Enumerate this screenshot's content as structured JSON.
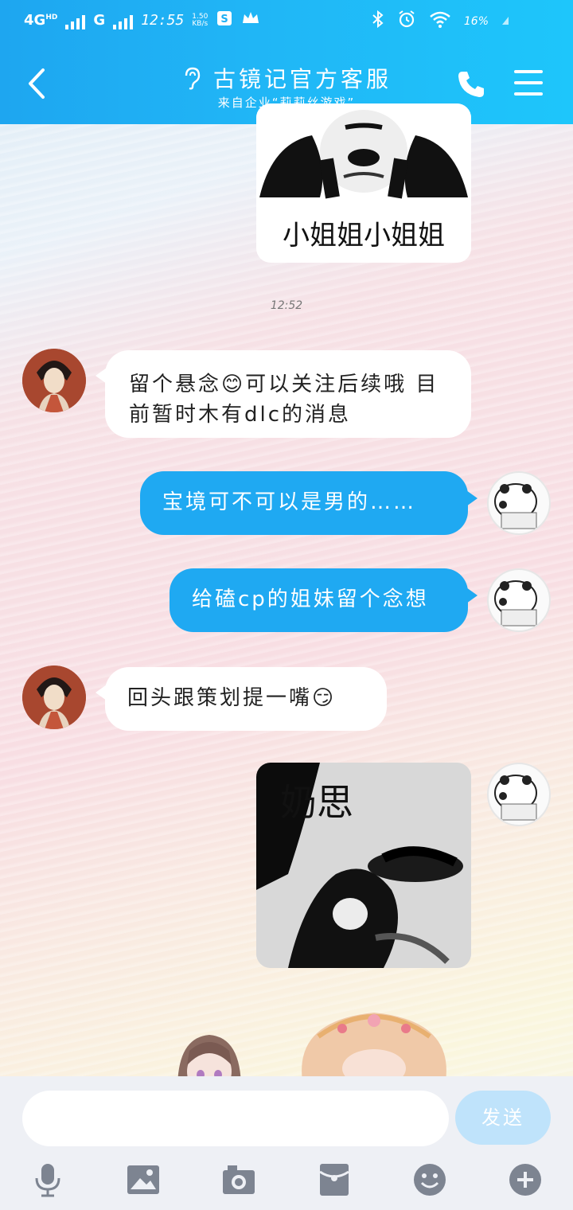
{
  "status_bar": {
    "network": "4G",
    "hd": "HD",
    "network2": "G",
    "time": "12:55",
    "speed_value": "1.50",
    "speed_unit": "KB/s",
    "battery": "16%"
  },
  "header": {
    "title": "古镜记官方客服",
    "subtitle": "来自企业“莉莉丝游戏”"
  },
  "chat": {
    "sticker1_text": "小姐姐小姐姐",
    "timestamp": "12:52",
    "msg1": "留个悬念😊可以关注后续哦 目前暂时木有dlc的消息",
    "msg2": "宝境可不可以是男的……",
    "msg3": "给磕cp的姐妹留个念想",
    "msg4": "回头跟策划提一嘴😏",
    "sticker2_text": "奶思"
  },
  "composer": {
    "send_label": "发送"
  },
  "colors": {
    "header": "#20b6f6",
    "out_bubble": "#1fa9f2",
    "send_disabled": "#bfe3fb"
  }
}
